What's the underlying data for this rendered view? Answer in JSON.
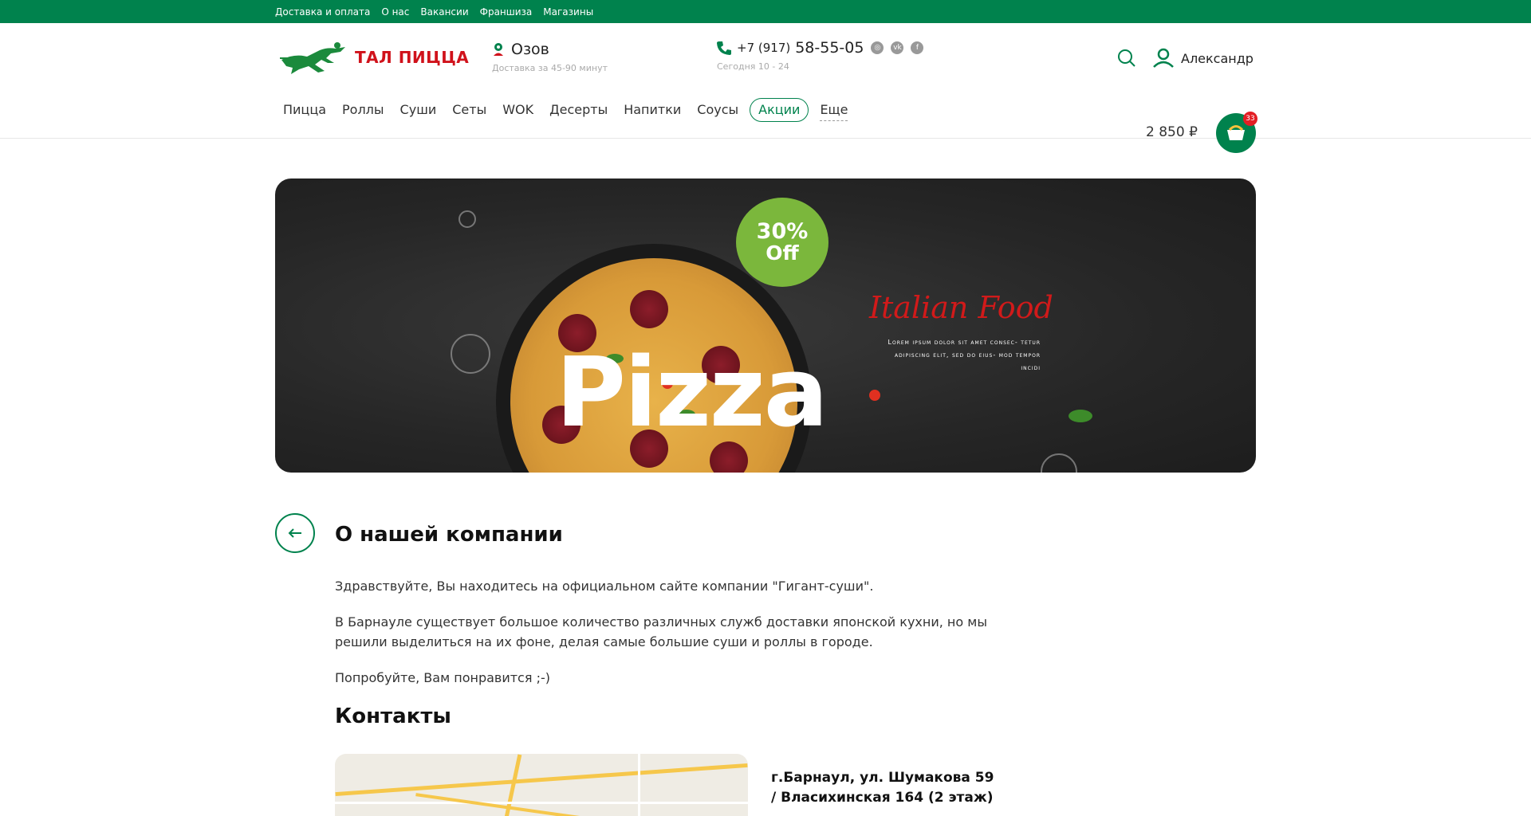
{
  "topbar": {
    "links": [
      "Доставка и оплата",
      "О нас",
      "Вакансии",
      "Франшиза",
      "Магазины"
    ]
  },
  "header": {
    "brand": "ТАЛ ПИЦЦА",
    "city": "Озов",
    "city_sub": "Доставка за 45-90 минут",
    "phone_prefix": "+7 (917)",
    "phone_main": "58-55-05",
    "phone_sub": "Сегодня 10 - 24",
    "user_name": "Александр",
    "cart_total": "2 850 ₽",
    "cart_count": "33"
  },
  "nav": {
    "items": [
      "Пицца",
      "Роллы",
      "Суши",
      "Сеты",
      "WOK",
      "Десерты",
      "Напитки",
      "Соусы"
    ],
    "active": "Акции",
    "more": "Еще"
  },
  "banner": {
    "pct": "30%",
    "off": "Off",
    "word": "Pizza",
    "script": "Italian Food",
    "lorem": "Lorem ipsum dolor sit amet consec- tetur adipiscing elit, sed do eius- mod tempor incidi"
  },
  "page": {
    "title": "О нашей компании",
    "p1": "Здравствуйте, Вы находитесь на официальном сайте компании \"Гигант-суши\".",
    "p2": "В Барнауле существует большое количество различных служб доставки японской кухни, но мы решили выделиться на их фоне, делая самые большие суши и роллы в городе.",
    "p3": "Попробуйте, Вам понравится ;-)",
    "contacts_title": "Контакты",
    "address": "г.Барнаул, ул. Шумакова 59 / Власихинская 164 (2 этаж)"
  },
  "colors": {
    "brand_green": "#00824d",
    "brand_red": "#d0121b"
  }
}
